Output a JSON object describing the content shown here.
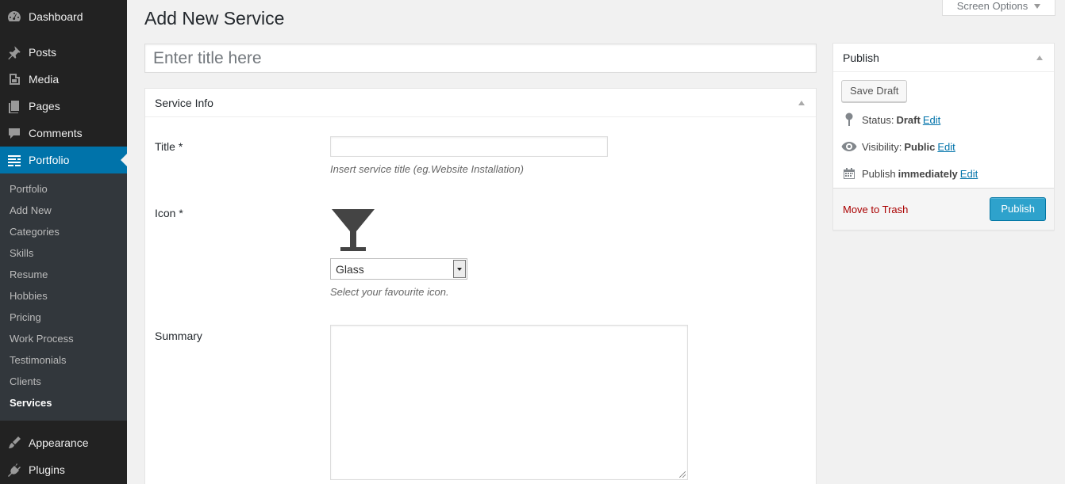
{
  "sidebar": {
    "top_items": [
      {
        "label": "Dashboard",
        "icon": "dashboard-icon"
      },
      {
        "label": "Posts",
        "icon": "pin-icon"
      },
      {
        "label": "Media",
        "icon": "media-icon"
      },
      {
        "label": "Pages",
        "icon": "pages-icon"
      },
      {
        "label": "Comments",
        "icon": "comment-icon"
      },
      {
        "label": "Portfolio",
        "icon": "portfolio-icon",
        "current": true
      }
    ],
    "submenu": [
      "Portfolio",
      "Add New",
      "Categories",
      "Skills",
      "Resume",
      "Hobbies",
      "Pricing",
      "Work Process",
      "Testimonials",
      "Clients",
      "Services"
    ],
    "submenu_current": "Services",
    "bottom_items": [
      {
        "label": "Appearance",
        "icon": "brush-icon"
      },
      {
        "label": "Plugins",
        "icon": "plugin-icon"
      }
    ]
  },
  "header": {
    "title": "Add New Service",
    "screen_options": "Screen Options"
  },
  "title_field": {
    "placeholder": "Enter title here",
    "value": ""
  },
  "service_info": {
    "heading": "Service Info",
    "title_label": "Title *",
    "title_value": "",
    "title_desc": "Insert service title (eg.Website Installation)",
    "icon_label": "Icon *",
    "icon_preview": "glass-icon",
    "icon_selected": "Glass",
    "icon_desc": "Select your favourite icon.",
    "summary_label": "Summary",
    "summary_value": ""
  },
  "publish": {
    "heading": "Publish",
    "save_draft": "Save Draft",
    "status_label": "Status:",
    "status_value": "Draft",
    "visibility_label": "Visibility:",
    "visibility_value": "Public",
    "publish_label": "Publish",
    "publish_value": "immediately",
    "edit": "Edit",
    "move_to_trash": "Move to Trash",
    "publish_button": "Publish"
  },
  "colors": {
    "sidebar_bg": "#222222",
    "submenu_bg": "#32373c",
    "accent": "#0073aa",
    "publish_button": "#2ea2cc",
    "trash_link": "#aa0000"
  }
}
